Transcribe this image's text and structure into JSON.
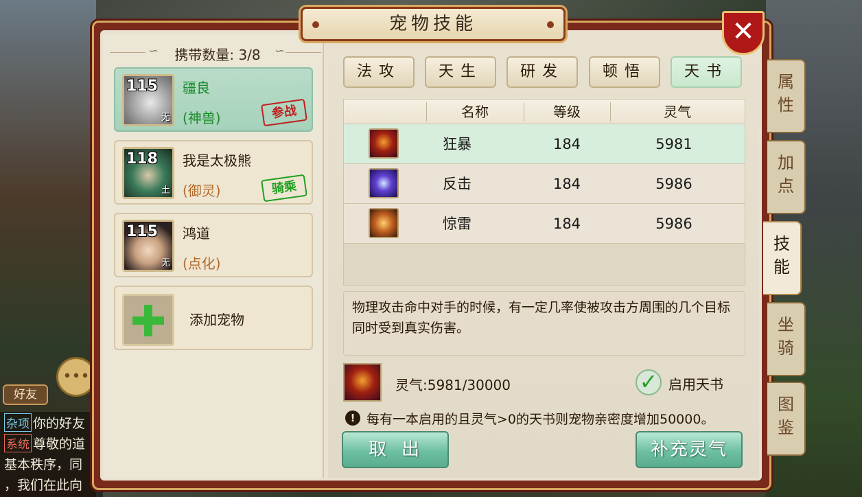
{
  "window": {
    "title": "宠物技能"
  },
  "pets": {
    "carry_label": "携带数量: 3/8",
    "list": [
      {
        "level": "115",
        "element": "无",
        "name": "疆良",
        "type": "(神兽)",
        "stamp": "参战"
      },
      {
        "level": "118",
        "element": "土",
        "name": "我是太极熊",
        "type": "(御灵)",
        "stamp": "骑乘"
      },
      {
        "level": "115",
        "element": "无",
        "name": "鸿道",
        "type": "(点化)",
        "stamp": ""
      }
    ],
    "add_label": "添加宠物"
  },
  "tabs": [
    "法攻",
    "天生",
    "研发",
    "顿悟",
    "天书"
  ],
  "active_tab": "天书",
  "table": {
    "headers": [
      "名称",
      "等级",
      "灵气"
    ],
    "rows": [
      {
        "icon": "rage-skill-icon",
        "name": "狂暴",
        "level": "184",
        "lingqi": "5981"
      },
      {
        "icon": "counter-skill-icon",
        "name": "反击",
        "level": "184",
        "lingqi": "5986"
      },
      {
        "icon": "thunder-skill-icon",
        "name": "惊雷",
        "level": "184",
        "lingqi": "5986"
      }
    ]
  },
  "description": "物理攻击命中对手的时候，有一定几率使被攻击方周围的几个目标同时受到真实伤害。",
  "lingqi_status": "灵气:5981/30000",
  "enable_label": "启用天书",
  "notice": "每有一本启用的且灵气>0的天书则宠物亲密度增加50000。",
  "buttons": {
    "cancel": "取出",
    "supply": "补充灵气"
  },
  "side_tabs": [
    "属性",
    "加点",
    "技能",
    "坐骑",
    "图鉴"
  ],
  "background": {
    "friend_button": "好友",
    "chat": [
      {
        "tag": "杂项",
        "text": "你的好友"
      },
      {
        "tag": "系统",
        "text": "尊敬的道"
      },
      {
        "tag": "",
        "text": "基本秩序，同"
      },
      {
        "tag": "",
        "text": "，我们在此向"
      }
    ]
  },
  "colors": {
    "frame": "#7a2a1a",
    "accent_green": "#6ec0a2",
    "stamp_red": "#c02020",
    "stamp_green": "#20a020"
  }
}
